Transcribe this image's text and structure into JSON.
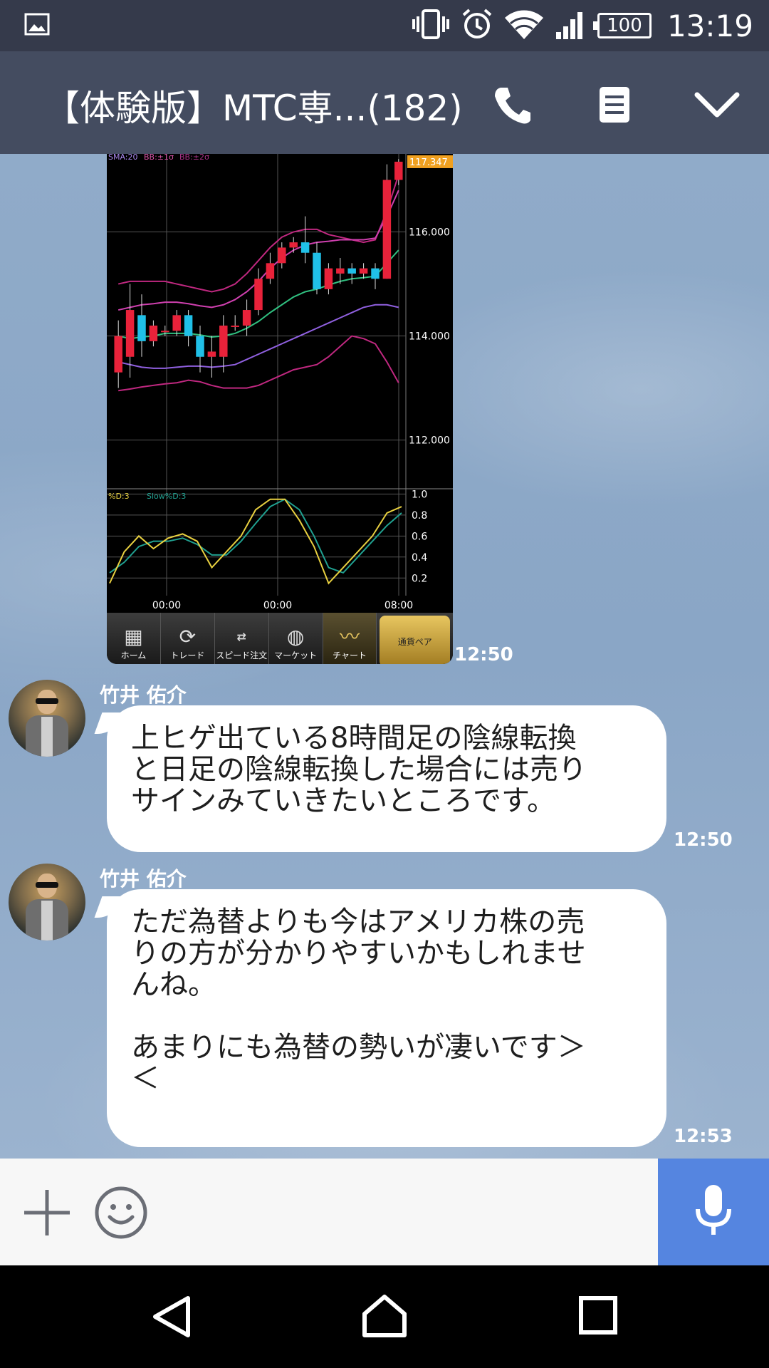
{
  "status_bar": {
    "time": "13:19",
    "battery": "100",
    "icons": [
      "image-icon",
      "vibrate-icon",
      "alarm-icon",
      "wifi-icon",
      "signal-icon",
      "battery-icon"
    ]
  },
  "header": {
    "title": "【体験版】MTC専...(182)",
    "icons": [
      "phone-icon",
      "notes-icon",
      "chevron-down-icon"
    ]
  },
  "chart_message": {
    "timestamp": "12:50",
    "chart_data": [
      {
        "type": "line",
        "legend": [
          "SMA:20",
          "BB:±1σ",
          "BB:±2σ"
        ],
        "price_label": "117.347",
        "y_ticks": [
          "116.000",
          "114.000",
          "112.000"
        ],
        "ylim": [
          111.2,
          117.5
        ],
        "candles": [
          {
            "o": 113.3,
            "c": 114.0,
            "h": 114.3,
            "l": 113.0
          },
          {
            "o": 113.6,
            "c": 114.5,
            "h": 115.0,
            "l": 113.2
          },
          {
            "o": 114.4,
            "c": 113.9,
            "h": 114.8,
            "l": 113.6
          },
          {
            "o": 113.9,
            "c": 114.2,
            "h": 114.3,
            "l": 113.8
          },
          {
            "o": 114.1,
            "c": 114.1,
            "h": 114.2,
            "l": 114.0
          },
          {
            "o": 114.1,
            "c": 114.4,
            "h": 114.5,
            "l": 114.0
          },
          {
            "o": 114.4,
            "c": 114.0,
            "h": 114.5,
            "l": 113.8
          },
          {
            "o": 114.0,
            "c": 113.6,
            "h": 114.2,
            "l": 113.3
          },
          {
            "o": 113.6,
            "c": 113.7,
            "h": 114.0,
            "l": 113.2
          },
          {
            "o": 113.6,
            "c": 114.2,
            "h": 114.4,
            "l": 113.3
          },
          {
            "o": 114.2,
            "c": 114.2,
            "h": 114.4,
            "l": 114.1
          },
          {
            "o": 114.2,
            "c": 114.5,
            "h": 114.7,
            "l": 114.0
          },
          {
            "o": 114.5,
            "c": 115.1,
            "h": 115.3,
            "l": 114.4
          },
          {
            "o": 115.1,
            "c": 115.4,
            "h": 115.6,
            "l": 115.0
          },
          {
            "o": 115.4,
            "c": 115.7,
            "h": 115.8,
            "l": 115.3
          },
          {
            "o": 115.7,
            "c": 115.8,
            "h": 115.9,
            "l": 115.6
          },
          {
            "o": 115.8,
            "c": 115.6,
            "h": 116.3,
            "l": 115.4
          },
          {
            "o": 115.6,
            "c": 114.9,
            "h": 115.8,
            "l": 114.8
          },
          {
            "o": 114.9,
            "c": 115.3,
            "h": 115.4,
            "l": 114.8
          },
          {
            "o": 115.2,
            "c": 115.3,
            "h": 115.5,
            "l": 115.0
          },
          {
            "o": 115.3,
            "c": 115.2,
            "h": 115.4,
            "l": 115.0
          },
          {
            "o": 115.2,
            "c": 115.3,
            "h": 115.4,
            "l": 115.1
          },
          {
            "o": 115.3,
            "c": 115.1,
            "h": 115.4,
            "l": 114.9
          },
          {
            "o": 115.1,
            "c": 117.0,
            "h": 117.3,
            "l": 115.1
          },
          {
            "o": 117.0,
            "c": 117.35,
            "h": 117.4,
            "l": 116.9
          }
        ],
        "sma": [
          114.0,
          113.95,
          113.98,
          114.0,
          114.05,
          114.05,
          114.05,
          114.02,
          113.98,
          114.0,
          114.05,
          114.15,
          114.28,
          114.45,
          114.6,
          114.75,
          114.85,
          114.9,
          114.98,
          115.05,
          115.1,
          115.12,
          115.15,
          115.4,
          115.65
        ],
        "bb_upper1": [
          114.5,
          114.55,
          114.6,
          114.62,
          114.65,
          114.65,
          114.62,
          114.58,
          114.55,
          114.6,
          114.7,
          114.85,
          115.05,
          115.3,
          115.5,
          115.65,
          115.75,
          115.8,
          115.82,
          115.85,
          115.85,
          115.85,
          115.88,
          116.3,
          116.8
        ],
        "bb_lower1": [
          113.5,
          113.45,
          113.4,
          113.38,
          113.38,
          113.4,
          113.42,
          113.42,
          113.4,
          113.42,
          113.45,
          113.55,
          113.65,
          113.75,
          113.85,
          113.95,
          114.05,
          114.15,
          114.25,
          114.35,
          114.45,
          114.55,
          114.6,
          114.6,
          114.55
        ],
        "bb_upper2": [
          115.0,
          115.05,
          115.05,
          115.05,
          115.05,
          115.0,
          114.95,
          114.9,
          114.85,
          114.9,
          115.0,
          115.2,
          115.45,
          115.7,
          115.9,
          116.0,
          116.05,
          116.05,
          115.95,
          115.9,
          115.85,
          115.8,
          115.85,
          116.4,
          117.1
        ],
        "bb_lower2": [
          112.95,
          112.98,
          113.02,
          113.05,
          113.08,
          113.1,
          113.15,
          113.12,
          113.05,
          113.0,
          113.0,
          113.0,
          113.05,
          113.15,
          113.25,
          113.35,
          113.4,
          113.45,
          113.6,
          113.8,
          114.0,
          113.95,
          113.85,
          113.5,
          113.1
        ],
        "sub_chart": {
          "legend": [
            "%D:3",
            "Slow%D:3"
          ],
          "y_ticks": [
            "1.0",
            "0.8",
            "0.6",
            "0.4",
            "0.2"
          ],
          "ylim": [
            0.1,
            1.05
          ],
          "pct_d": [
            0.15,
            0.45,
            0.6,
            0.48,
            0.58,
            0.62,
            0.55,
            0.3,
            0.45,
            0.6,
            0.85,
            0.95,
            0.95,
            0.75,
            0.5,
            0.15,
            0.3,
            0.45,
            0.6,
            0.82,
            0.88
          ],
          "slow_pct_d": [
            0.25,
            0.35,
            0.5,
            0.55,
            0.55,
            0.58,
            0.52,
            0.42,
            0.42,
            0.55,
            0.72,
            0.88,
            0.95,
            0.85,
            0.6,
            0.3,
            0.25,
            0.4,
            0.55,
            0.7,
            0.82
          ]
        },
        "x_ticks": [
          "00:00",
          "00:00",
          "08:00"
        ]
      }
    ],
    "toolbar": [
      {
        "label": "ホーム",
        "icon": "grid-icon"
      },
      {
        "label": "トレード",
        "icon": "refresh-icon"
      },
      {
        "label": "スピード注文",
        "icon": "speed-icon"
      },
      {
        "label": "マーケット",
        "icon": "globe-icon"
      },
      {
        "label": "チャート",
        "icon": "chart-icon"
      },
      {
        "label": "通貨ペア",
        "icon": "currency-icon"
      }
    ]
  },
  "messages": [
    {
      "sender": "竹井 佑介",
      "text": "上ヒゲ出ている8時間足の陰線転換\nと日足の陰線転換した場合には売り\nサインみていきたいところです。",
      "timestamp": "12:50"
    },
    {
      "sender": "竹井 佑介",
      "text": "ただ為替よりも今はアメリカ株の売\nりの方が分かりやすいかもしれませ\nんね。\n\nあまりにも為替の勢いが凄いです＞\n＜",
      "timestamp": "12:53"
    }
  ],
  "input_bar": {
    "icons": [
      "plus-icon",
      "emoji-icon",
      "mic-icon"
    ]
  },
  "nav_bar": {
    "icons": [
      "back-icon",
      "home-icon",
      "recents-icon"
    ]
  }
}
